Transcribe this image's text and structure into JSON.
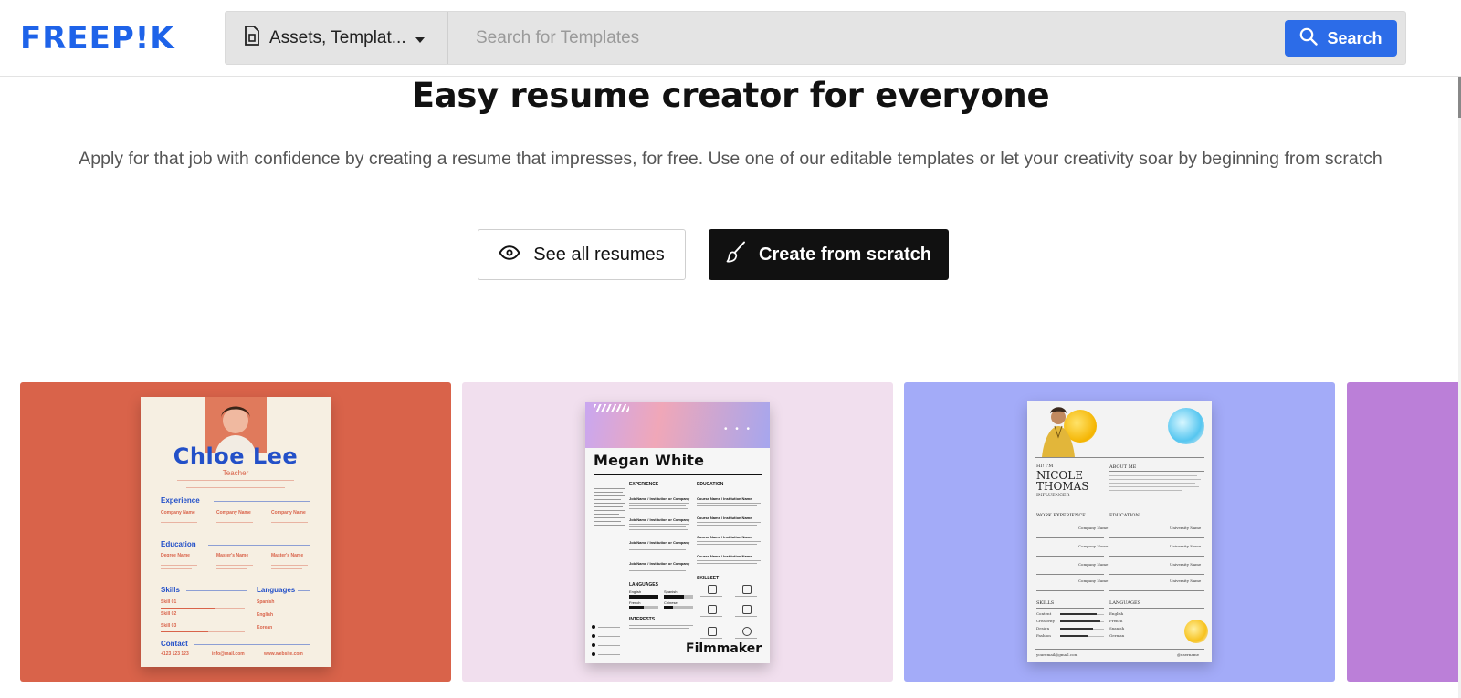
{
  "header": {
    "logo_text": "FREEP!K",
    "asset_select_label": "Assets, Templat...",
    "search_placeholder": "Search for Templates",
    "search_button_label": "Search"
  },
  "hero": {
    "title": "Easy resume creator for everyone",
    "subtitle": "Apply for that job with confidence by creating a resume that impresses, for free. Use one of our editable templates or let your creativity soar by beginning from scratch"
  },
  "actions": {
    "see_all_label": "See all resumes",
    "create_label": "Create from scratch"
  },
  "cards": [
    {
      "background": "#d9634a",
      "name": "Chloe Lee",
      "role": "Teacher",
      "sections": [
        "Experience",
        "Education",
        "Skills",
        "Languages",
        "Contact"
      ],
      "job_titles": [
        "Company Name",
        "Company Name",
        "Company Name"
      ],
      "degrees": [
        "Degree Name",
        "Master's Name",
        "Master's Name"
      ],
      "skills": [
        "Skill 01",
        "Skill 02",
        "Skill 03"
      ],
      "languages": [
        "Spanish",
        "English",
        "Korean"
      ],
      "contact": [
        "+123 123 123",
        "info@mail.com",
        "www.website.com"
      ]
    },
    {
      "background": "#f1dfee",
      "name": "Megan White",
      "sections": [
        "EXPERIENCE",
        "EDUCATION",
        "LANGUAGES",
        "SKILLSET",
        "INTERESTS"
      ],
      "company_line": "Job Name / Institution or Company",
      "course_line": "Course Name / Institution Name",
      "languages": [
        "English",
        "Spanish",
        "French",
        "Chinese"
      ],
      "footer": "Filmmaker"
    },
    {
      "background": "#a3abf8",
      "greeting": "HI! I'M",
      "name_line1": "NICOLE",
      "name_line2": "THOMAS",
      "role": "INFLUENCER",
      "sections": [
        "ABOUT ME",
        "WORK EXPERIENCE",
        "EDUCATION",
        "SKILLS",
        "LANGUAGES"
      ],
      "company": "Company Name",
      "university": "University Name",
      "skills": [
        "Content",
        "Creativity",
        "Design",
        "Fashion"
      ],
      "languages": [
        "English",
        "French",
        "Spanish",
        "German"
      ],
      "email": "youremail@gmail.com",
      "handle": "@username"
    },
    {
      "background": "#bb7fd8"
    }
  ],
  "colors": {
    "brand_blue": "#1e63e9",
    "search_button": "#2c6ce8",
    "dark_button": "#111111"
  }
}
